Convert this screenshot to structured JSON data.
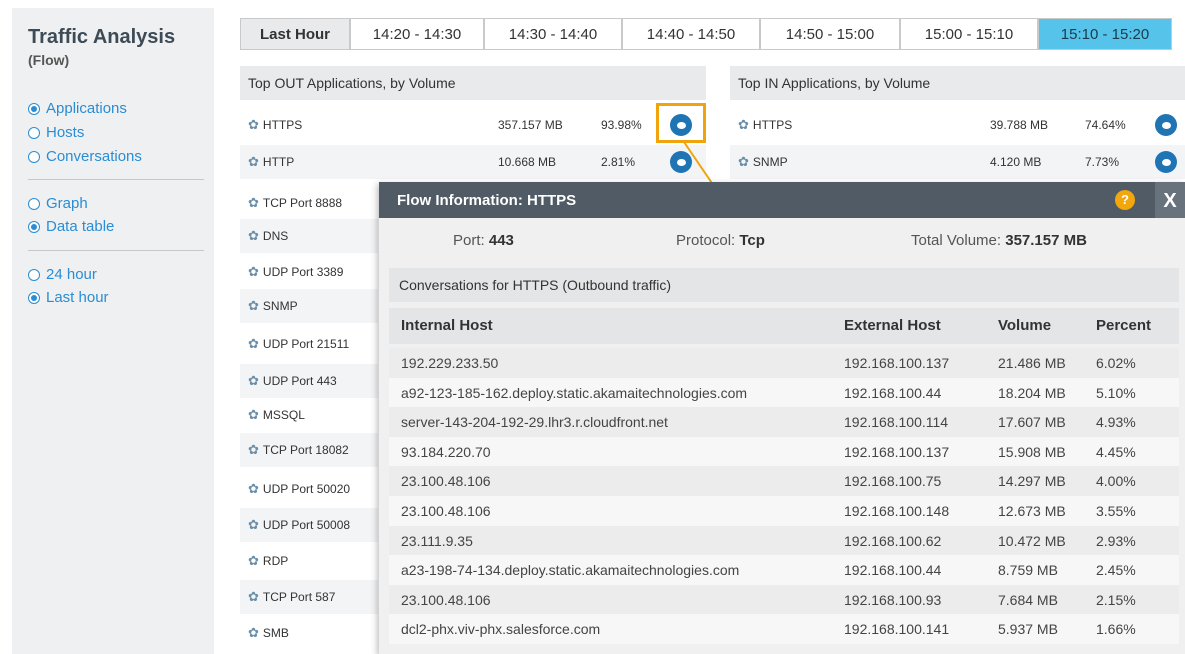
{
  "sidebar": {
    "title": "Traffic Analysis",
    "subtitle": "(Flow)",
    "groups": [
      [
        {
          "label": "Applications",
          "selected": true
        },
        {
          "label": "Hosts",
          "selected": false
        },
        {
          "label": "Conversations",
          "selected": false
        }
      ],
      [
        {
          "label": "Graph",
          "selected": false
        },
        {
          "label": "Data table",
          "selected": true
        }
      ],
      [
        {
          "label": "24 hour",
          "selected": false
        },
        {
          "label": "Last hour",
          "selected": true
        }
      ]
    ]
  },
  "tabs": [
    "Last Hour",
    "14:20 - 14:30",
    "14:30 - 14:40",
    "14:40 - 14:50",
    "14:50 - 15:00",
    "15:00 - 15:10",
    "15:10 - 15:20"
  ],
  "active_tab": "15:10 - 15:20",
  "out_table": {
    "title": "Top OUT Applications, by Volume",
    "rows": [
      {
        "name": "HTTPS",
        "volume": "357.157 MB",
        "percent": "93.98%"
      },
      {
        "name": "HTTP",
        "volume": "10.668 MB",
        "percent": "2.81%"
      },
      {
        "name": "TCP Port 8888"
      },
      {
        "name": "DNS"
      },
      {
        "name": "UDP Port 3389"
      },
      {
        "name": "SNMP"
      },
      {
        "name": "UDP Port 21511"
      },
      {
        "name": "UDP Port 443"
      },
      {
        "name": "MSSQL"
      },
      {
        "name": "TCP Port 18082"
      },
      {
        "name": "UDP Port 50020"
      },
      {
        "name": "UDP Port 50008"
      },
      {
        "name": "RDP"
      },
      {
        "name": "TCP Port 587"
      },
      {
        "name": "SMB"
      }
    ]
  },
  "in_table": {
    "title": "Top IN Applications, by Volume",
    "rows": [
      {
        "name": "HTTPS",
        "volume": "39.788 MB",
        "percent": "74.64%"
      },
      {
        "name": "SNMP",
        "volume": "4.120 MB",
        "percent": "7.73%"
      }
    ]
  },
  "popup": {
    "title": "Flow Information: HTTPS",
    "port_label": "Port:",
    "port": "443",
    "protocol_label": "Protocol:",
    "protocol": "Tcp",
    "total_label": "Total Volume:",
    "total": "357.157 MB",
    "conversations_title": "Conversations for HTTPS (Outbound traffic)",
    "columns": [
      "Internal Host",
      "External Host",
      "Volume",
      "Percent"
    ],
    "rows": [
      [
        "192.229.233.50",
        "192.168.100.137",
        "21.486 MB",
        "6.02%"
      ],
      [
        "a92-123-185-162.deploy.static.akamaitechnologies.com",
        "192.168.100.44",
        "18.204 MB",
        "5.10%"
      ],
      [
        "server-143-204-192-29.lhr3.r.cloudfront.net",
        "192.168.100.114",
        "17.607 MB",
        "4.93%"
      ],
      [
        "93.184.220.70",
        "192.168.100.137",
        "15.908 MB",
        "4.45%"
      ],
      [
        "23.100.48.106",
        "192.168.100.75",
        "14.297 MB",
        "4.00%"
      ],
      [
        "23.100.48.106",
        "192.168.100.148",
        "12.673 MB",
        "3.55%"
      ],
      [
        "23.111.9.35",
        "192.168.100.62",
        "10.472 MB",
        "2.93%"
      ],
      [
        "a23-198-74-134.deploy.static.akamaitechnologies.com",
        "192.168.100.44",
        "8.759 MB",
        "2.45%"
      ],
      [
        "23.100.48.106",
        "192.168.100.93",
        "7.684 MB",
        "2.15%"
      ],
      [
        "dcl2-phx.viv-phx.salesforce.com",
        "192.168.100.141",
        "5.937 MB",
        "1.66%"
      ]
    ],
    "help_icon": "?",
    "close_label": "X"
  },
  "colors": {
    "accent": "#2a8dd4",
    "active_tab": "#55c3ea",
    "highlight_box": "#f0a30a",
    "popup_header": "#505b66"
  }
}
